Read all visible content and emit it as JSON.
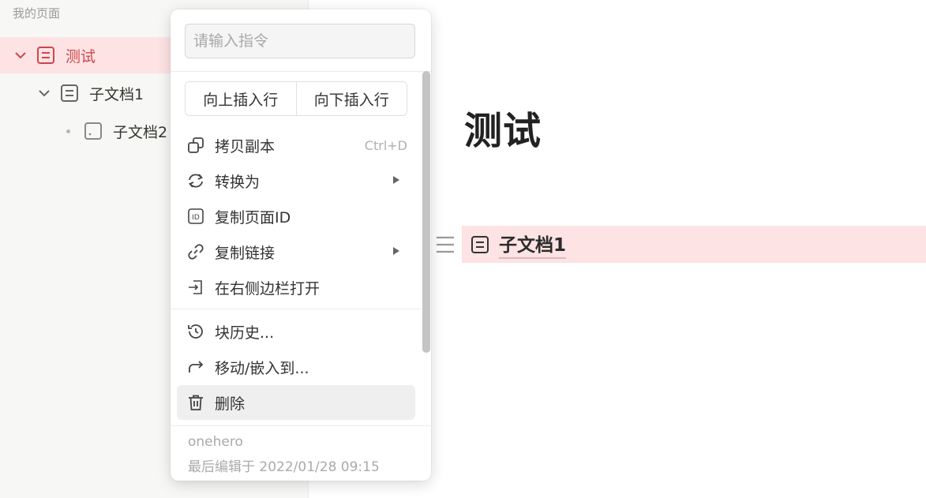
{
  "sidebar": {
    "section_title": "我的页面",
    "items": [
      {
        "label": "测试",
        "expanded": true
      },
      {
        "label": "子文档1",
        "expanded": true
      },
      {
        "label": "子文档2"
      }
    ]
  },
  "main": {
    "title": "测试",
    "block_label": "子文档1"
  },
  "menu": {
    "search_placeholder": "请输入指令",
    "insert_above": "向上插入行",
    "insert_below": "向下插入行",
    "items": [
      {
        "label": "拷贝副本",
        "shortcut": "Ctrl+D",
        "icon": "copy-icon"
      },
      {
        "label": "转换为",
        "icon": "convert-icon",
        "submenu": true
      },
      {
        "label": "复制页面ID",
        "icon": "id-icon"
      },
      {
        "label": "复制链接",
        "icon": "link-icon",
        "submenu": true
      },
      {
        "label": "在右侧边栏打开",
        "icon": "open-sidebar-icon"
      },
      {
        "label": "块历史...",
        "icon": "history-icon"
      },
      {
        "label": "移动/嵌入到...",
        "icon": "move-icon"
      },
      {
        "label": "删除",
        "icon": "trash-icon"
      }
    ],
    "footer": {
      "author": "onehero",
      "edited": "最后编辑于 2022/01/28 09:15"
    }
  },
  "colors": {
    "active_bg": "#fde3e3",
    "active_text": "#d0454c"
  }
}
